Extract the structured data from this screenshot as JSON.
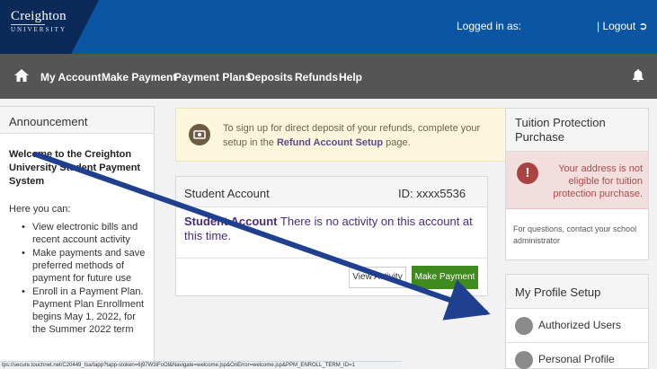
{
  "header": {
    "logo_name": "Creighton",
    "logo_sub": "UNIVERSITY",
    "logged_in_label": "Logged in as:",
    "logout_label": "| Logout"
  },
  "nav": {
    "items": [
      "My Account",
      "Make Payment",
      "Payment Plans",
      "Deposits",
      "Refunds",
      "Help"
    ]
  },
  "announcement": {
    "heading": "Announcement",
    "title": "Welcome to the Creighton University Student Payment System",
    "lead": "Here you can:",
    "bullets": [
      "View electronic bills and recent account activity",
      "Make payments and save preferred methods of payment for future use",
      "Enroll in a Payment Plan. Payment Plan Enrollment begins May 1, 2022, for the Summer 2022 term"
    ]
  },
  "notice": {
    "text_before": "To sign up for direct deposit of your refunds, complete your setup in the ",
    "link": "Refund Account Setup",
    "text_after": " page."
  },
  "student_account": {
    "title": "Student Account",
    "id": "ID: xxxx5536",
    "message_bold": "Student Account",
    "message": " There is no activity on this account at this time.",
    "activity_button": "View Activity",
    "pay_button": "Make Payment"
  },
  "tuition": {
    "heading": "Tuition Protection Purchase",
    "alert": "Your address is not eligible for tuition protection purchase.",
    "note": "For questions, contact your school administrator"
  },
  "profile": {
    "heading": "My Profile Setup",
    "items": [
      "Authorized Users",
      "Personal Profile"
    ]
  },
  "status_url": "tps://secure.touchnet.net/C20449_tsa/tapp?tapp-stoken=6j97W3iFoOl&Navigate=welcome.jsp&OnError=welcome.jsp&PPM_ENROLL_TERM_ID=1",
  "colors": {
    "header_blue": "#0a56a3",
    "nav_gray": "#555555",
    "pay_green": "#3e8a1d",
    "alert_red": "#a94442",
    "arrow_blue": "#1f3f8f"
  }
}
